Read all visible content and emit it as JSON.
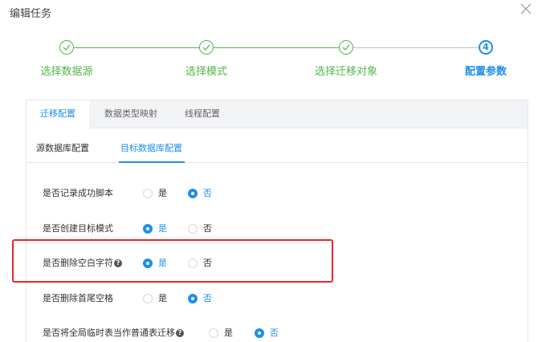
{
  "dialog": {
    "title": "编辑任务"
  },
  "steps": [
    {
      "label": "选择数据源",
      "status": "done"
    },
    {
      "label": "选择模式",
      "status": "done"
    },
    {
      "label": "选择迁移对象",
      "status": "done"
    },
    {
      "label": "配置参数",
      "status": "active",
      "number": "4"
    }
  ],
  "tabs": [
    {
      "label": "迁移配置",
      "active": true
    },
    {
      "label": "数据类型映射",
      "active": false
    },
    {
      "label": "线程配置",
      "active": false
    }
  ],
  "subtabs": [
    {
      "label": "源数据库配置",
      "active": false
    },
    {
      "label": "目标数据库配置",
      "active": true
    }
  ],
  "options": [
    {
      "label": "是否记录成功脚本",
      "help": false,
      "yes": "是",
      "no": "否",
      "selected": "否"
    },
    {
      "label": "是否创建目标模式",
      "help": false,
      "yes": "是",
      "no": "否",
      "selected": "是"
    },
    {
      "label": "是否删除空白字符",
      "help": true,
      "yes": "是",
      "no": "否",
      "selected": "是"
    },
    {
      "label": "是否删除首尾空格",
      "help": false,
      "yes": "是",
      "no": "否",
      "selected": "否"
    },
    {
      "label": "是否将全局临时表当作普通表迁移",
      "help": true,
      "yes": "是",
      "no": "否",
      "selected": "否"
    }
  ],
  "colors": {
    "done": "#53b64a",
    "active": "#1d8ff0",
    "highlight": "#e8262b"
  },
  "icons": {
    "close": "close-icon",
    "check": "check-icon",
    "help": "question-circle-icon"
  }
}
